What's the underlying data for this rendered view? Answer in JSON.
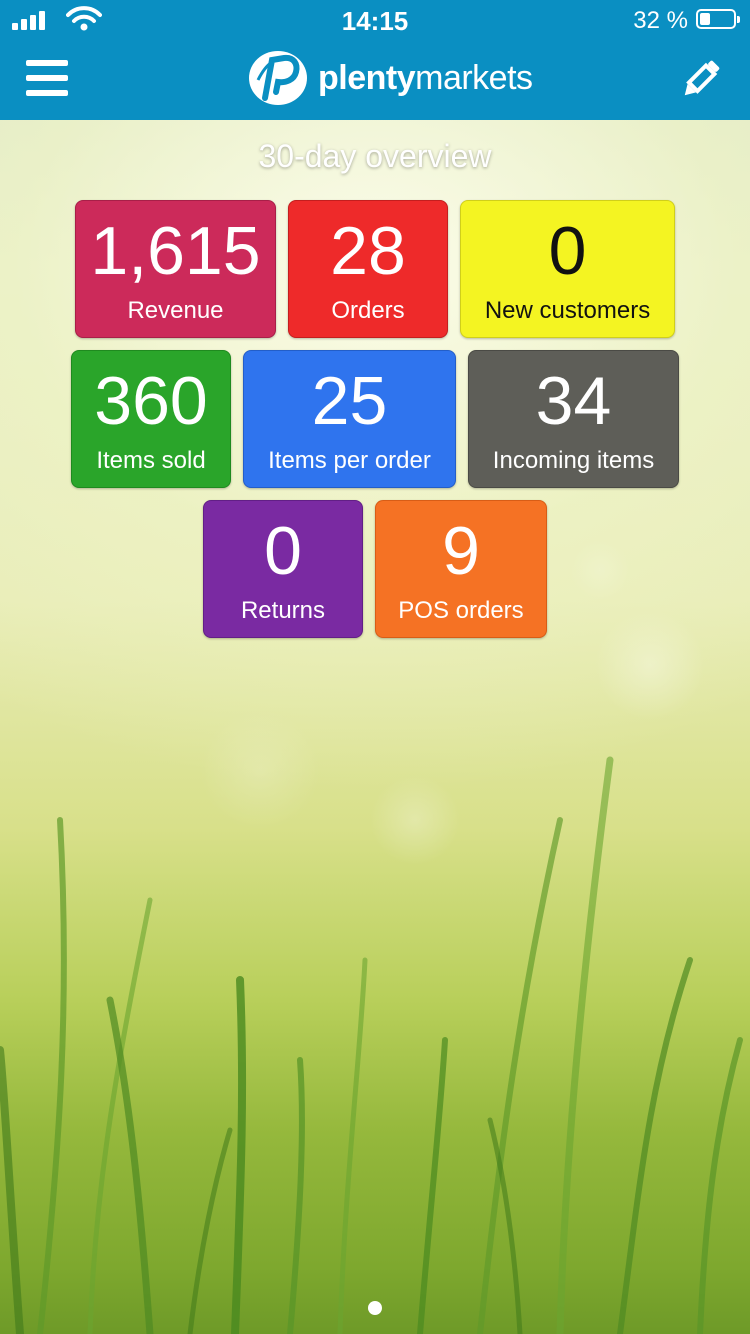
{
  "status_bar": {
    "time": "14:15",
    "battery_percent": "32 %",
    "battery_level": 0.32,
    "signal_icon": "signal-bars-icon",
    "wifi_icon": "wifi-icon",
    "battery_icon": "battery-icon"
  },
  "nav": {
    "menu_icon": "hamburger-menu-icon",
    "logo": {
      "icon": "plentymarkets-logo-icon",
      "text_bold": "plenty",
      "text_light": "markets"
    },
    "edit_icon": "pencil-icon"
  },
  "colors": {
    "header": "#0a8fc2",
    "revenue": "#cc2a5a",
    "orders": "#ee2a2a",
    "new_customers": "#f4f422",
    "items_sold": "#2aa52a",
    "items_per_order": "#2f74ee",
    "incoming_items": "#5e5e58",
    "returns": "#7a2aa2",
    "pos_orders": "#f57224"
  },
  "overview": {
    "title": "30-day overview",
    "tiles": [
      {
        "value": "1,615",
        "label": "Revenue"
      },
      {
        "value": "28",
        "label": "Orders"
      },
      {
        "value": "0",
        "label": "New customers"
      },
      {
        "value": "360",
        "label": "Items sold"
      },
      {
        "value": "25",
        "label": "Items per order"
      },
      {
        "value": "34",
        "label": "Incoming items"
      },
      {
        "value": "0",
        "label": "Returns"
      },
      {
        "value": "9",
        "label": "POS orders"
      }
    ]
  },
  "pager": {
    "page_count": 1,
    "current_page": 1
  }
}
